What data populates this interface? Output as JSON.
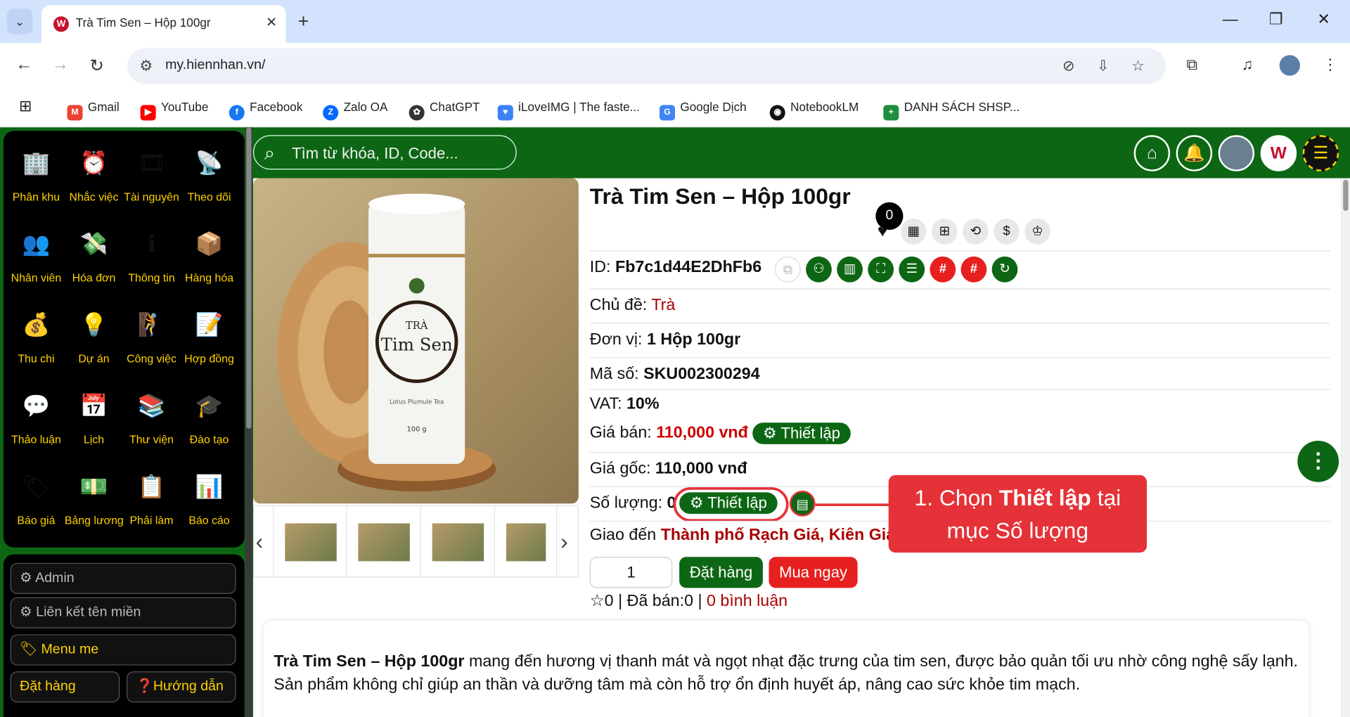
{
  "browser": {
    "tab_title": "Trà Tim Sen – Hộp 100gr",
    "url": "my.hiennhan.vn/",
    "bookmarks": [
      "Gmail",
      "YouTube",
      "Facebook",
      "Zalo OA",
      "ChatGPT",
      "iLoveIMG | The faste...",
      "Google Dịch",
      "NotebookLM",
      "DANH SÁCH SHSP..."
    ]
  },
  "sidebar": {
    "apps": [
      "Phân khu",
      "Nhắc việc",
      "Tài nguyên",
      "Theo dõi",
      "Nhân viên",
      "Hóa đơn",
      "Thông tin",
      "Hàng hóa",
      "Thu chi",
      "Dự án",
      "Công việc",
      "Hợp đồng",
      "Thảo luận",
      "Lịch",
      "Thư viện",
      "Đào tạo",
      "Báo giá",
      "Bảng lương",
      "Phải làm",
      "Báo cáo"
    ],
    "admin": "Admin",
    "domain_link": "Liên kết tên miền",
    "menu_me": "Menu me",
    "order": "Đặt hàng",
    "guide": "Hướng dẫn"
  },
  "header": {
    "search_placeholder": "Tìm từ khóa, ID, Code..."
  },
  "product": {
    "title": "Trà Tim Sen – Hộp 100gr",
    "fav_count": "0",
    "id_label": "ID:",
    "id": "Fb7c1d44E2DhFb6",
    "topic_label": "Chủ đề:",
    "topic": "Trà",
    "unit_label": "Đơn vị:",
    "unit": "1 Hộp 100gr",
    "code_label": "Mã số:",
    "code": "SKU002300294",
    "vat_label": "VAT:",
    "vat": "10%",
    "price_label": "Giá bán:",
    "price": "110,000 vnđ",
    "cost_label": "Giá gốc:",
    "cost": "110,000 vnđ",
    "qty_label": "Số lượng:",
    "qty": "0",
    "setup": "Thiết lập",
    "ship_label": "Giao đến",
    "ship": "Thành phố Rạch Giá, Kiên Gia",
    "order_qty": "1",
    "add_order": "Đặt hàng",
    "buy_now": "Mua ngay",
    "stars": "0",
    "sold": "| Đã bán:0 |",
    "comments": "0 bình luận",
    "desc_bold": "Trà Tim Sen – Hộp 100gr",
    "desc_text": " mang đến hương vị thanh mát và ngọt nhạt đặc trưng của tim sen, được bảo quản tối ưu nhờ công nghệ sấy lạnh. Sản phẩm không chỉ giúp an thần và dưỡng tâm mà còn hỗ trợ ổn định huyết áp, nâng cao sức khỏe tim mạch.",
    "pack_tra": "TRÀ",
    "pack_name": "Tim Sen",
    "pack_sub": "Lotus Plumule Tea",
    "pack_w": "100 g"
  },
  "callout": {
    "pre": "1. Chọn ",
    "bold": "Thiết lập",
    "post": " tại",
    "line2": "mục Số lượng"
  }
}
